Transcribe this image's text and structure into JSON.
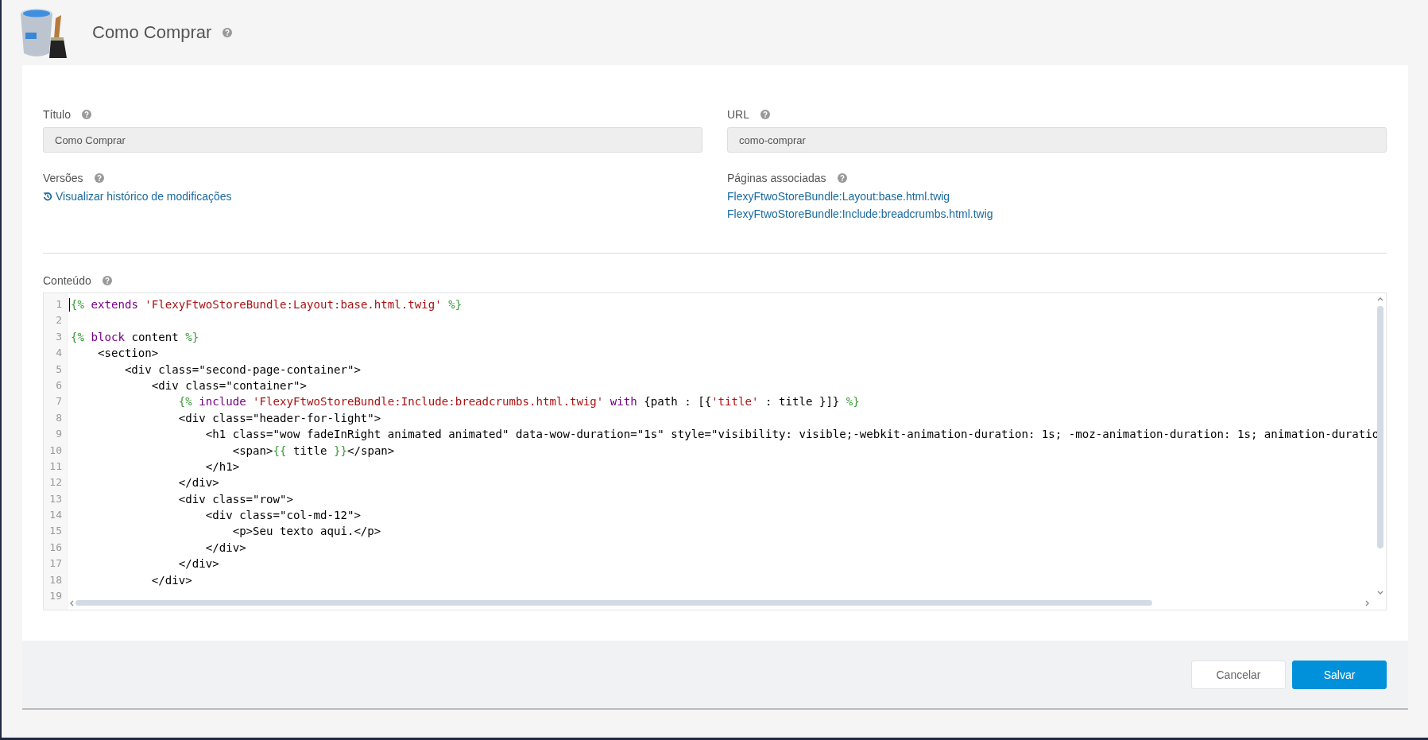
{
  "header": {
    "title": "Como Comprar"
  },
  "fields": [
    {
      "label": "Título",
      "value": "Como Comprar"
    },
    {
      "label": "URL",
      "value": "como-comprar"
    }
  ],
  "versions": {
    "label": "Versões",
    "link": "Visualizar histórico de modificações"
  },
  "associated_pages": {
    "label": "Páginas associadas",
    "links": [
      "FlexyFtwoStoreBundle:Layout:base.html.twig",
      "FlexyFtwoStoreBundle:Include:breadcrumbs.html.twig"
    ]
  },
  "content": {
    "label": "Conteúdo",
    "lines": [
      {
        "number": "1",
        "segments": [
          {
            "kind": "delim",
            "text": "{%"
          },
          {
            "kind": "keyword",
            "text": " extends "
          },
          {
            "kind": "string",
            "text": "'FlexyFtwoStoreBundle:Layout:base.html.twig' "
          },
          {
            "kind": "delim",
            "text": "%}"
          }
        ]
      },
      {
        "number": "2"
      },
      {
        "number": "3",
        "segments": [
          {
            "kind": "delim",
            "text": "{%"
          },
          {
            "kind": "keyword",
            "text": " block"
          },
          {
            "kind": "plain",
            "text": " content "
          },
          {
            "kind": "delim",
            "text": "%}"
          }
        ]
      },
      {
        "number": "4",
        "segments": [
          {
            "kind": "plain",
            "text": "    <section>"
          }
        ]
      },
      {
        "number": "5",
        "segments": [
          {
            "kind": "plain",
            "text": "        <div class=\"second-page-container\">"
          }
        ]
      },
      {
        "number": "6",
        "segments": [
          {
            "kind": "plain",
            "text": "            <div class=\"container\">"
          }
        ]
      },
      {
        "number": "7",
        "segments": [
          {
            "kind": "delim",
            "text": "                {%"
          },
          {
            "kind": "keyword",
            "text": " include "
          },
          {
            "kind": "string",
            "text": "'FlexyFtwoStoreBundle:Include:breadcrumbs.html.twig' "
          },
          {
            "kind": "keyword",
            "text": "with"
          },
          {
            "kind": "plain",
            "text": " {path : [{"
          },
          {
            "kind": "string",
            "text": "'title'"
          },
          {
            "kind": "plain",
            "text": " : title }]} "
          },
          {
            "kind": "delim",
            "text": "%}"
          }
        ]
      },
      {
        "number": "8",
        "segments": [
          {
            "kind": "plain",
            "text": "                <div class=\"header-for-light\">"
          }
        ]
      },
      {
        "number": "9",
        "segments": [
          {
            "kind": "plain",
            "text": "                    <h1 class=\"wow fadeInRight animated animated\" data-wow-duration=\"1s\" style=\"visibility: visible;-webkit-animation-duration: 1s; -moz-animation-duration: 1s; animation-duratio"
          }
        ]
      },
      {
        "number": "10",
        "segments": [
          {
            "kind": "plain",
            "text": "                        <span>"
          },
          {
            "kind": "delim",
            "text": "{{"
          },
          {
            "kind": "plain",
            "text": " title "
          },
          {
            "kind": "delim",
            "text": "}}"
          },
          {
            "kind": "plain",
            "text": "</span>"
          }
        ]
      },
      {
        "number": "11",
        "segments": [
          {
            "kind": "plain",
            "text": "                    </h1>"
          }
        ]
      },
      {
        "number": "12",
        "segments": [
          {
            "kind": "plain",
            "text": "                </div>"
          }
        ]
      },
      {
        "number": "13",
        "segments": [
          {
            "kind": "plain",
            "text": "                <div class=\"row\">"
          }
        ]
      },
      {
        "number": "14",
        "segments": [
          {
            "kind": "plain",
            "text": "                    <div class=\"col-md-12\">"
          }
        ]
      },
      {
        "number": "15",
        "segments": [
          {
            "kind": "plain",
            "text": "                        <p>Seu texto aqui.</p>"
          }
        ]
      },
      {
        "number": "16",
        "segments": [
          {
            "kind": "plain",
            "text": "                    </div>"
          }
        ]
      },
      {
        "number": "17",
        "segments": [
          {
            "kind": "plain",
            "text": "                </div>"
          }
        ]
      },
      {
        "number": "18",
        "segments": [
          {
            "kind": "plain",
            "text": "            </div>"
          }
        ]
      },
      {
        "number": "19"
      }
    ]
  },
  "buttons": [
    {
      "kind": "secondary",
      "label": "Cancelar"
    },
    {
      "kind": "primary",
      "label": "Salvar"
    }
  ]
}
